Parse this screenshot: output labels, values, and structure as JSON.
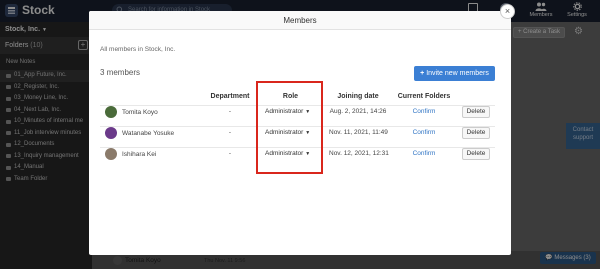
{
  "app": {
    "name": "Stock"
  },
  "topbar": {
    "search_placeholder": "Search for information in Stock",
    "members_label": "Members",
    "settings_label": "Settings"
  },
  "sidebar": {
    "team_name": "Stock, Inc.",
    "folders_label": "Folders",
    "folders_count": "(10)",
    "new_notes_label": "New Notes",
    "folders": [
      "01_App Future, Inc.",
      "02_Register, Inc.",
      "03_Money Line, Inc.",
      "04_Next Lab, Inc.",
      "10_Minutes of internal me",
      "11_Job interview minutes",
      "12_Documents",
      "13_Inquiry management",
      "14_Manual",
      "Team Folder"
    ]
  },
  "background": {
    "create_task_label": "+ Create a Task",
    "contact_support_label": "Contact support",
    "bottom_user_name": "Tomita Koyo",
    "bottom_date": "Thu Nov. 11 9:56",
    "messages_label": "Messages (3)"
  },
  "modal": {
    "title": "Members",
    "subtitle": "All members in Stock, Inc.",
    "member_count": "3 members",
    "invite_label": "Invite new members",
    "columns": {
      "department": "Department",
      "role": "Role",
      "joining_date": "Joining date",
      "current_folders": "Current Folders"
    },
    "members": [
      {
        "name": "Tomita Koyo",
        "department": "-",
        "role": "Administrator",
        "joining_date": "Aug. 2, 2021, 14:26",
        "folders_action": "Confirm",
        "delete_label": "Delete",
        "avatar_color": "#4a6b3a"
      },
      {
        "name": "Watanabe Yosuke",
        "department": "-",
        "role": "Administrator",
        "joining_date": "Nov. 11, 2021, 11:49",
        "folders_action": "Confirm",
        "delete_label": "Delete",
        "avatar_color": "#6b3a8a"
      },
      {
        "name": "Ishihara Kei",
        "department": "-",
        "role": "Administrator",
        "joining_date": "Nov. 12, 2021, 12:31",
        "folders_action": "Confirm",
        "delete_label": "Delete",
        "avatar_color": "#8a7a6a"
      }
    ]
  },
  "colors": {
    "accent_blue": "#3b7fd4",
    "highlight_red": "#d9261c",
    "link_blue": "#2f74c4"
  }
}
